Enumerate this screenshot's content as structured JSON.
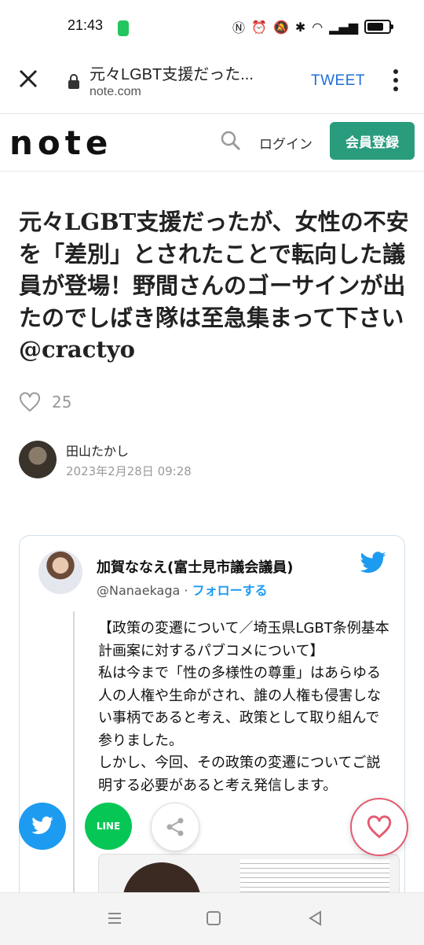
{
  "status": {
    "time": "21:43"
  },
  "browser": {
    "title": "元々LGBT支援だった...",
    "domain": "note.com",
    "tweet_label": "TWEET"
  },
  "header": {
    "logo": "note",
    "login_label": "ログイン",
    "signup_label": "会員登録",
    "brand_color": "#2a9c7e"
  },
  "article": {
    "title": "元々LGBT支援だったが、女性の不安を「差別」とされたことで転向した議員が登場！野間さんのゴーサインが出たのでしばき隊は至急集まって下さい @cractyo",
    "likes": "25",
    "author": "田山たかし",
    "date": "2023年2月28日 09:28"
  },
  "tweet": {
    "name": "加賀ななえ(富士見市議会議員)",
    "handle": "@Nanaekaga",
    "separator": " · ",
    "follow_label": "フォローする",
    "text": "【政策の変遷について／埼玉県LGBT条例基本計画案に対するパブコメについて】\n私は今まで「性の多様性の尊重」はあらゆる人の人権や生命がされ、誰の人権も侵害しない事柄であると考え、政策として取り組んで参りました。\nしかし、今回、その政策の変遷についてご説明する必要があると考え発信します。"
  },
  "share": {
    "line_label": "LINE"
  }
}
